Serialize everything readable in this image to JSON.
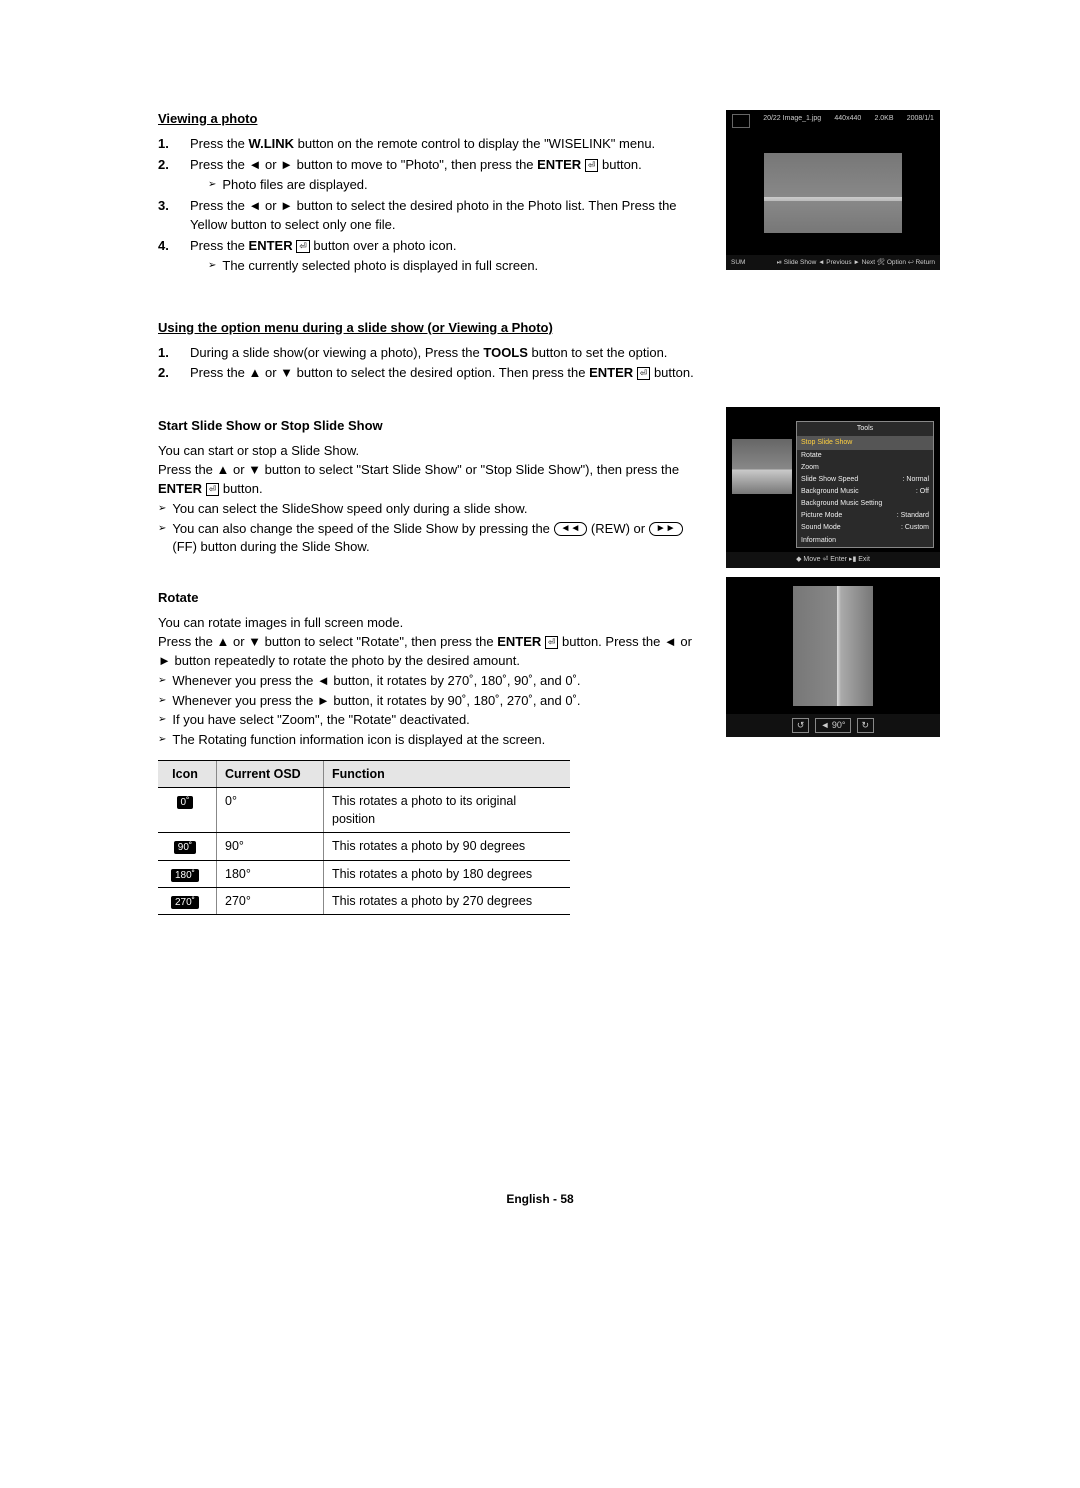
{
  "section1": {
    "title": "Viewing a photo",
    "steps": [
      {
        "num": "1.",
        "text": "Press the |W.LINK| button on the remote control to display the \"WISELINK\" menu."
      },
      {
        "num": "2.",
        "text": "Press the ◄ or ► button to move to \"Photo\", then press the |ENTER| [E] button.",
        "sub": [
          "Photo files are displayed."
        ]
      },
      {
        "num": "3.",
        "text": "Press the ◄ or ► button to select the desired photo in the Photo list. Then Press the Yellow button to select only one file."
      },
      {
        "num": "4.",
        "text": "Press the |ENTER| [E] button over a photo icon.",
        "sub": [
          "The currently selected photo is displayed in full screen."
        ]
      }
    ]
  },
  "section2": {
    "title": "Using the option menu during a slide show (or Viewing a Photo)",
    "steps": [
      {
        "num": "1.",
        "text": "During a slide show(or viewing a photo), Press the |TOOLS| button to set the option."
      },
      {
        "num": "2.",
        "text": "Press the ▲ or ▼ button to select the desired option. Then press the |ENTER| [E] button."
      }
    ]
  },
  "slideShow": {
    "title": "Start Slide Show or Stop Slide Show",
    "lines": [
      "You can start or stop a Slide Show.",
      "Press the ▲ or ▼ button to select \"Start Slide Show\" or \"Stop Slide Show\"), then press the |ENTER| [E] button."
    ],
    "tips": [
      "You can select the SlideShow speed only during a slide show.",
      "You can also change the speed of the Slide Show by pressing the (◄◄) (REW) or (►►) (FF) button during the Slide Show."
    ]
  },
  "rotate": {
    "title": "Rotate",
    "lines": [
      "You can rotate images in full screen mode.",
      "Press the ▲ or ▼ button to select \"Rotate\", then press the |ENTER| [E] button. Press the ◄ or ► button repeatedly to rotate the photo by the desired amount."
    ],
    "tips": [
      "Whenever you press the ◄ button, it rotates by 270˚, 180˚, 90˚, and 0˚.",
      "Whenever you press the ► button, it rotates by 90˚, 180˚, 270˚, and 0˚.",
      "If you have select \"Zoom\", the \"Rotate\" deactivated.",
      "The Rotating function information icon is displayed at the screen."
    ],
    "tableHead": {
      "icon": "Icon",
      "osd": "Current OSD",
      "fn": "Function"
    },
    "rows": [
      {
        "badge": "0˚",
        "osd": "0°",
        "fn": "This rotates a photo to its original position"
      },
      {
        "badge": "90˚",
        "osd": "90°",
        "fn": "This rotates a photo by 90 degrees"
      },
      {
        "badge": "180˚",
        "osd": "180°",
        "fn": "This rotates a photo by 180 degrees"
      },
      {
        "badge": "270˚",
        "osd": "270°",
        "fn": "This rotates a photo by 270 degrees"
      }
    ]
  },
  "shot1": {
    "topIndex": "20/22",
    "file": "Image_1.jpg",
    "res": "440x440",
    "size": "2.0KB",
    "date": "2008/1/1",
    "sum": "SUM",
    "hints": [
      "⏯ Slide Show",
      "◄ Previous",
      "► Next",
      "🛠 Option",
      "↩ Return"
    ]
  },
  "shot2": {
    "toolsTitle": "Tools",
    "items": [
      {
        "label": "Stop Slide Show",
        "val": "",
        "sel": true
      },
      {
        "label": "Rotate",
        "val": ""
      },
      {
        "label": "Zoom",
        "val": ""
      },
      {
        "label": "Slide Show Speed",
        "val": "Normal"
      },
      {
        "label": "Background Music",
        "val": "Off"
      },
      {
        "label": "Background Music Setting",
        "val": ""
      },
      {
        "label": "Picture Mode",
        "val": "Standard"
      },
      {
        "label": "Sound Mode",
        "val": "Custom"
      },
      {
        "label": "Information",
        "val": ""
      }
    ],
    "hints": "◆ Move   ⏎ Enter   ▸▮ Exit"
  },
  "shot3": {
    "deg": "90°",
    "leftIcon": "↺",
    "rightIcon": "↻",
    "arrow": "◄"
  },
  "footer": "English - 58"
}
